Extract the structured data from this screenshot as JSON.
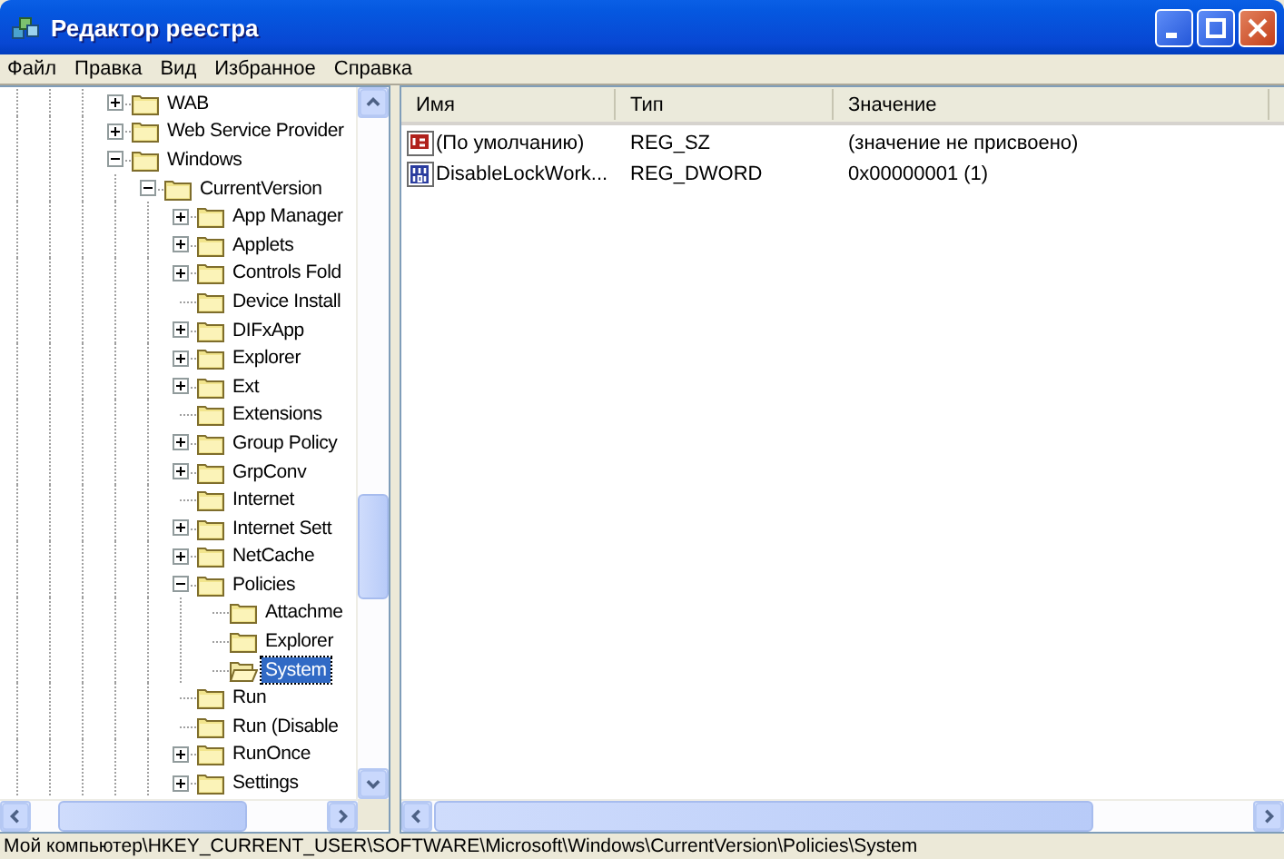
{
  "window": {
    "title": "Редактор реестра"
  },
  "menu": [
    "Файл",
    "Правка",
    "Вид",
    "Избранное",
    "Справка"
  ],
  "tree": {
    "items": [
      {
        "label": "WAB",
        "kind": "node",
        "expanded": false,
        "selected": false
      },
      {
        "label": "Web Service Provider",
        "kind": "node",
        "expanded": false,
        "selected": false
      },
      {
        "label": "Windows",
        "kind": "node",
        "expanded": true,
        "selected": false,
        "children": [
          {
            "label": "CurrentVersion",
            "kind": "node",
            "expanded": true,
            "selected": false,
            "children": [
              {
                "label": "App Manager",
                "kind": "node",
                "expanded": false,
                "selected": false
              },
              {
                "label": "Applets",
                "kind": "node",
                "expanded": false,
                "selected": false
              },
              {
                "label": "Controls Fold",
                "kind": "node",
                "expanded": false,
                "selected": false
              },
              {
                "label": "Device Install",
                "kind": "leaf",
                "selected": false
              },
              {
                "label": "DIFxApp",
                "kind": "node",
                "expanded": false,
                "selected": false
              },
              {
                "label": "Explorer",
                "kind": "node",
                "expanded": false,
                "selected": false
              },
              {
                "label": "Ext",
                "kind": "node",
                "expanded": false,
                "selected": false
              },
              {
                "label": "Extensions",
                "kind": "leaf",
                "selected": false
              },
              {
                "label": "Group Policy",
                "kind": "node",
                "expanded": false,
                "selected": false
              },
              {
                "label": "GrpConv",
                "kind": "node",
                "expanded": false,
                "selected": false
              },
              {
                "label": "Internet",
                "kind": "leaf",
                "selected": false
              },
              {
                "label": "Internet Sett",
                "kind": "node",
                "expanded": false,
                "selected": false
              },
              {
                "label": "NetCache",
                "kind": "node",
                "expanded": false,
                "selected": false
              },
              {
                "label": "Policies",
                "kind": "node",
                "expanded": true,
                "selected": false,
                "children": [
                  {
                    "label": "Attachme",
                    "kind": "leaf",
                    "selected": false
                  },
                  {
                    "label": "Explorer",
                    "kind": "leaf",
                    "selected": false
                  },
                  {
                    "label": "System",
                    "kind": "leaf",
                    "selected": true
                  }
                ]
              },
              {
                "label": "Run",
                "kind": "leaf",
                "selected": false
              },
              {
                "label": "Run (Disable",
                "kind": "leaf",
                "selected": false
              },
              {
                "label": "RunOnce",
                "kind": "node",
                "expanded": false,
                "selected": false
              },
              {
                "label": "Settings",
                "kind": "node",
                "expanded": false,
                "selected": false
              }
            ]
          }
        ]
      }
    ]
  },
  "list": {
    "columns": [
      "Имя",
      "Тип",
      "Значение"
    ],
    "rows": [
      {
        "kind": "string",
        "name": "(По умолчанию)",
        "type": "REG_SZ",
        "value": "(значение не присвоено)"
      },
      {
        "kind": "binary",
        "name": "DisableLockWork...",
        "type": "REG_DWORD",
        "value": "0x00000001 (1)"
      }
    ]
  },
  "status_bar": "Мой компьютер\\HKEY_CURRENT_USER\\SOFTWARE\\Microsoft\\Windows\\CurrentVersion\\Policies\\System"
}
